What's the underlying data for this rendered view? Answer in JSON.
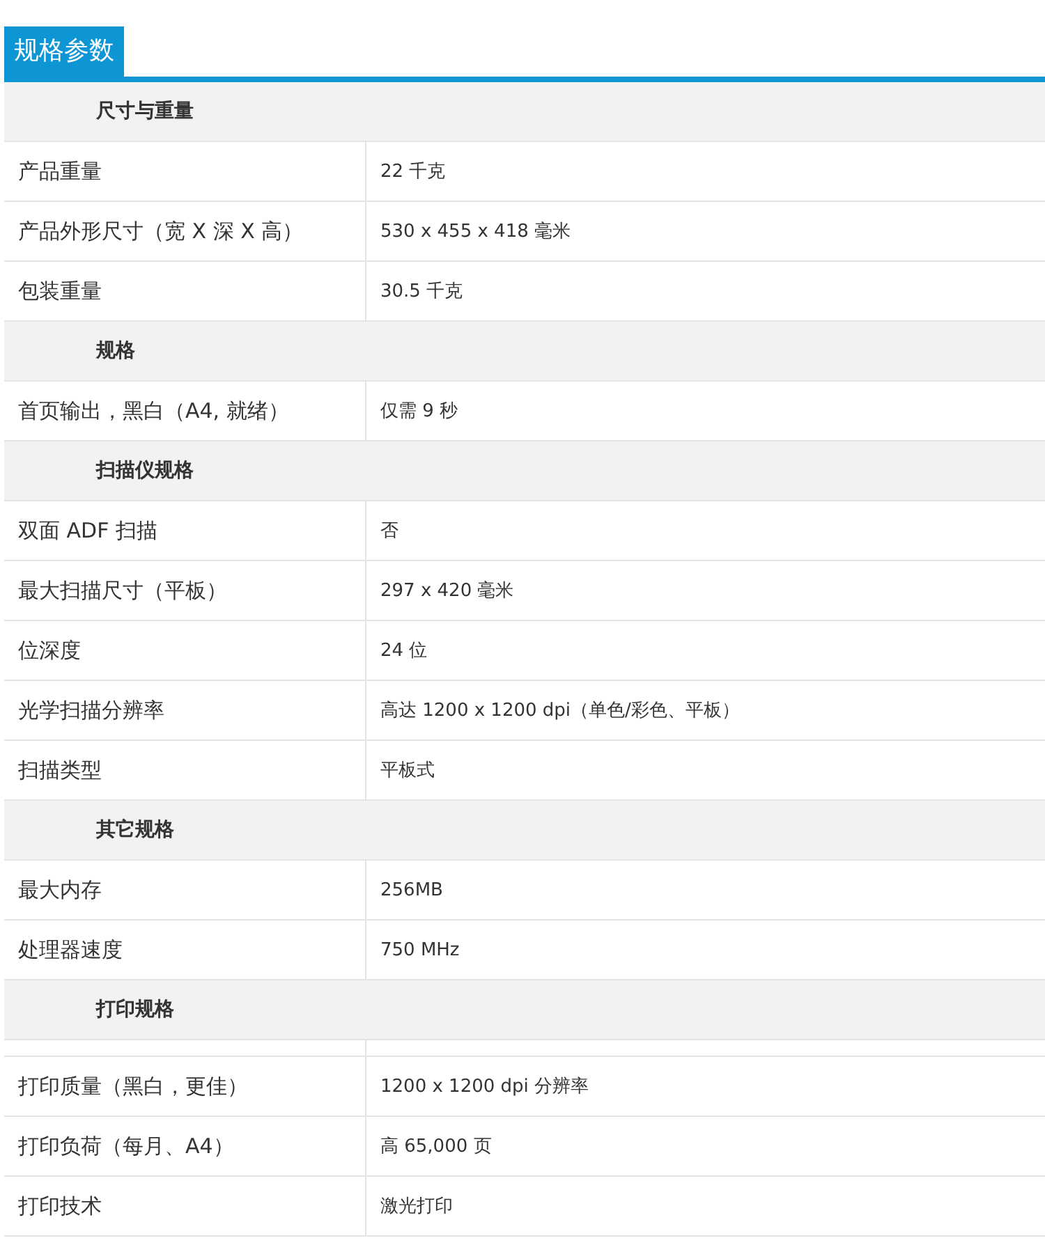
{
  "tab": {
    "label": "规格参数",
    "selected": true
  },
  "sections": [
    {
      "title": "尺寸与重量",
      "rows": [
        {
          "kind": "spec",
          "label": "产品重量",
          "value": "22 千克"
        },
        {
          "kind": "spec",
          "label": "产品外形尺寸（宽 X 深 X 高）",
          "value": "530 x 455 x 418 毫米"
        },
        {
          "kind": "spec",
          "label": "包装重量",
          "value": "30.5 千克"
        }
      ]
    },
    {
      "title": "规格",
      "rows": [
        {
          "kind": "spec",
          "label": "首页输出，黑白（A4, 就绪）",
          "value": "仅需 9 秒"
        }
      ]
    },
    {
      "title": "扫描仪规格",
      "rows": [
        {
          "kind": "spec",
          "label": "双面 ADF 扫描",
          "value": "否"
        },
        {
          "kind": "spec",
          "label": "最大扫描尺寸（平板）",
          "value": "297 x 420 毫米"
        },
        {
          "kind": "spec",
          "label": "位深度",
          "value": "24 位"
        },
        {
          "kind": "spec",
          "label": "光学扫描分辨率",
          "value": "高达 1200 x 1200 dpi（单色/彩色、平板）"
        },
        {
          "kind": "spec",
          "label": "扫描类型",
          "value": "平板式"
        }
      ]
    },
    {
      "title": "其它规格",
      "rows": [
        {
          "kind": "spec",
          "label": "最大内存",
          "value": "256MB"
        },
        {
          "kind": "spec",
          "label": "处理器速度",
          "value": "750 MHz"
        }
      ]
    },
    {
      "title": "打印规格",
      "rows": [
        {
          "kind": "blank"
        },
        {
          "kind": "spec",
          "label": "打印质量（黑白，更佳）",
          "value": "1200 x 1200 dpi 分辨率"
        },
        {
          "kind": "spec",
          "label": "打印负荷（每月、A4）",
          "value": "高 65,000 页"
        },
        {
          "kind": "spec",
          "label": "打印技术",
          "value": "激光打印"
        }
      ]
    }
  ]
}
